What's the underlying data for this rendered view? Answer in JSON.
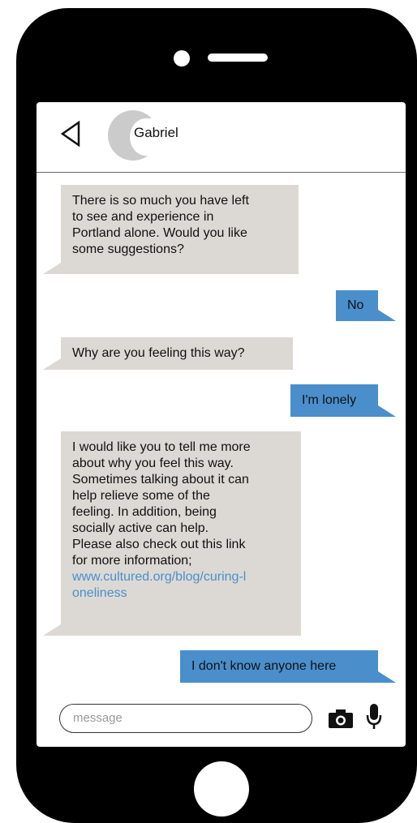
{
  "contact": {
    "name": "Gabriel"
  },
  "messages": [
    {
      "from": "other",
      "text": "There is so much you have left\nto see and experience in\nPortland alone. Would you like\nsome suggestions?"
    },
    {
      "from": "me",
      "text": "No"
    },
    {
      "from": "other",
      "text": "Why are you feeling this way?"
    },
    {
      "from": "me",
      "text": "I'm lonely"
    },
    {
      "from": "other",
      "text": "I would like you to tell me more\nabout why you feel this way.\nSometimes talking about it can\nhelp relieve some of the\nfeeling. In addition, being\nsocially active can help.\nPlease also check out this link\nfor more information;",
      "link": "www.cultured.org/blog/curing-l\noneliness"
    },
    {
      "from": "me",
      "text": "I don't know anyone here"
    }
  ],
  "composer": {
    "placeholder": "message"
  },
  "icons": {
    "back": "back-arrow-icon",
    "camera": "camera-icon",
    "mic": "microphone-icon"
  },
  "colors": {
    "incoming": "#dcd9d4",
    "outgoing": "#4a8fcc",
    "link": "#4a8fcc"
  }
}
